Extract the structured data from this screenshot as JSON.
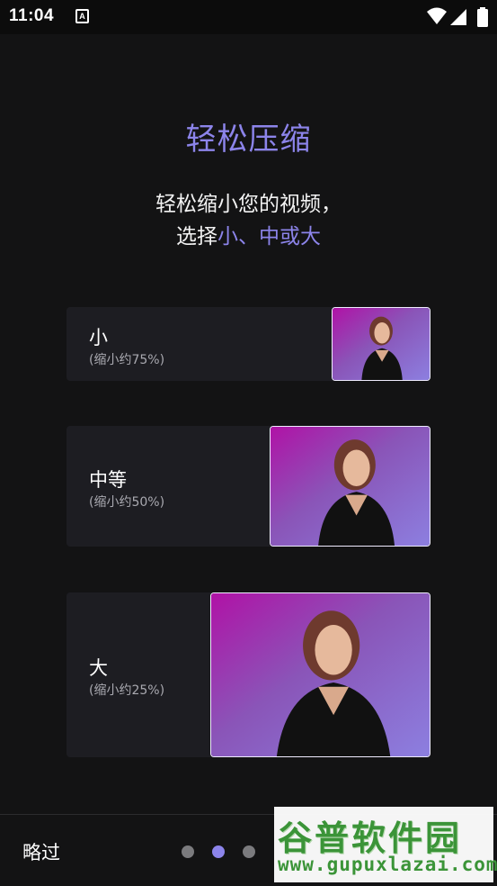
{
  "status_bar": {
    "time": "11:04",
    "notification_icon": "a-icon",
    "icons": [
      "wifi-icon",
      "signal-icon",
      "battery-icon"
    ]
  },
  "title": "轻松压缩",
  "subtitle": {
    "line1": "轻松缩小您的视频，",
    "line2_prefix": "选择",
    "line2_accent": "小、中或大"
  },
  "options": [
    {
      "label": "小",
      "sub": "(缩小约75%)"
    },
    {
      "label": "中等",
      "sub": "(缩小约50%)"
    },
    {
      "label": "大",
      "sub": "(缩小约25%)"
    }
  ],
  "bottom_nav": {
    "skip_label": "略过",
    "page_dots": 3,
    "active_dot_index": 1
  },
  "watermark": {
    "top_text": "谷普软件园",
    "bottom_text": "www.gupuxlazai.com"
  },
  "colors": {
    "accent": "#8c84ea",
    "background": "#131314",
    "card": "#1d1d22",
    "watermark": "#3d9a3a"
  }
}
